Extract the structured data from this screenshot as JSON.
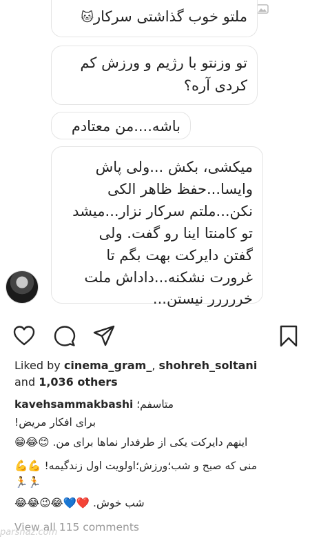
{
  "dm": {
    "messages": [
      {
        "lines": [
          "ملتو خوب گذاشتی سرکار"
        ],
        "trail_icon": "🐱"
      },
      {
        "lines": [
          "تو وزنتو با رژیم و ورزش کم",
          "کردی آره؟"
        ]
      },
      {
        "lines": [
          "باشه....من معتادم"
        ]
      },
      {
        "lines": [
          "میکشی، بکش ...ولی پاش",
          "وایسا...حفظ ظاهر الکی",
          "نکن...ملتم سرکار نزار...میشد",
          "تو کامنتا اینا رو گفت. ولی",
          "گفتن دایرکت بهت بگم تا",
          "غرورت نشکنه...داداش ملت",
          "خررررر نیستن..."
        ]
      }
    ],
    "sender_avatar": "avatar"
  },
  "actions": {
    "like_icon": "heart-outline-icon",
    "comment_icon": "comment-icon",
    "share_icon": "send-icon",
    "save_icon": "bookmark-icon"
  },
  "likes": {
    "prefix": "Liked by",
    "user1": "cinema_gram_",
    "sep": ",",
    "user2": "shohreh_soltani",
    "and": "and",
    "others": "1,036 others"
  },
  "caption": {
    "username": "kavehsammakbashi",
    "line1": "متاسفم؛",
    "line2": "برای افکار مریض!",
    "line3": "اینهم دایرکت یکی از طرفدار نماها برای من. 😊😂😁",
    "line4": "منی که صبح و شب؛ورزش؛اولویت اول زندگیمه! 💪💪",
    "line5": "🏃🏃",
    "line6": "شب خوش. ❤️💙😂😉😂😂"
  },
  "view_all": "View all 115 comments",
  "watermark": "parsnaz.com"
}
